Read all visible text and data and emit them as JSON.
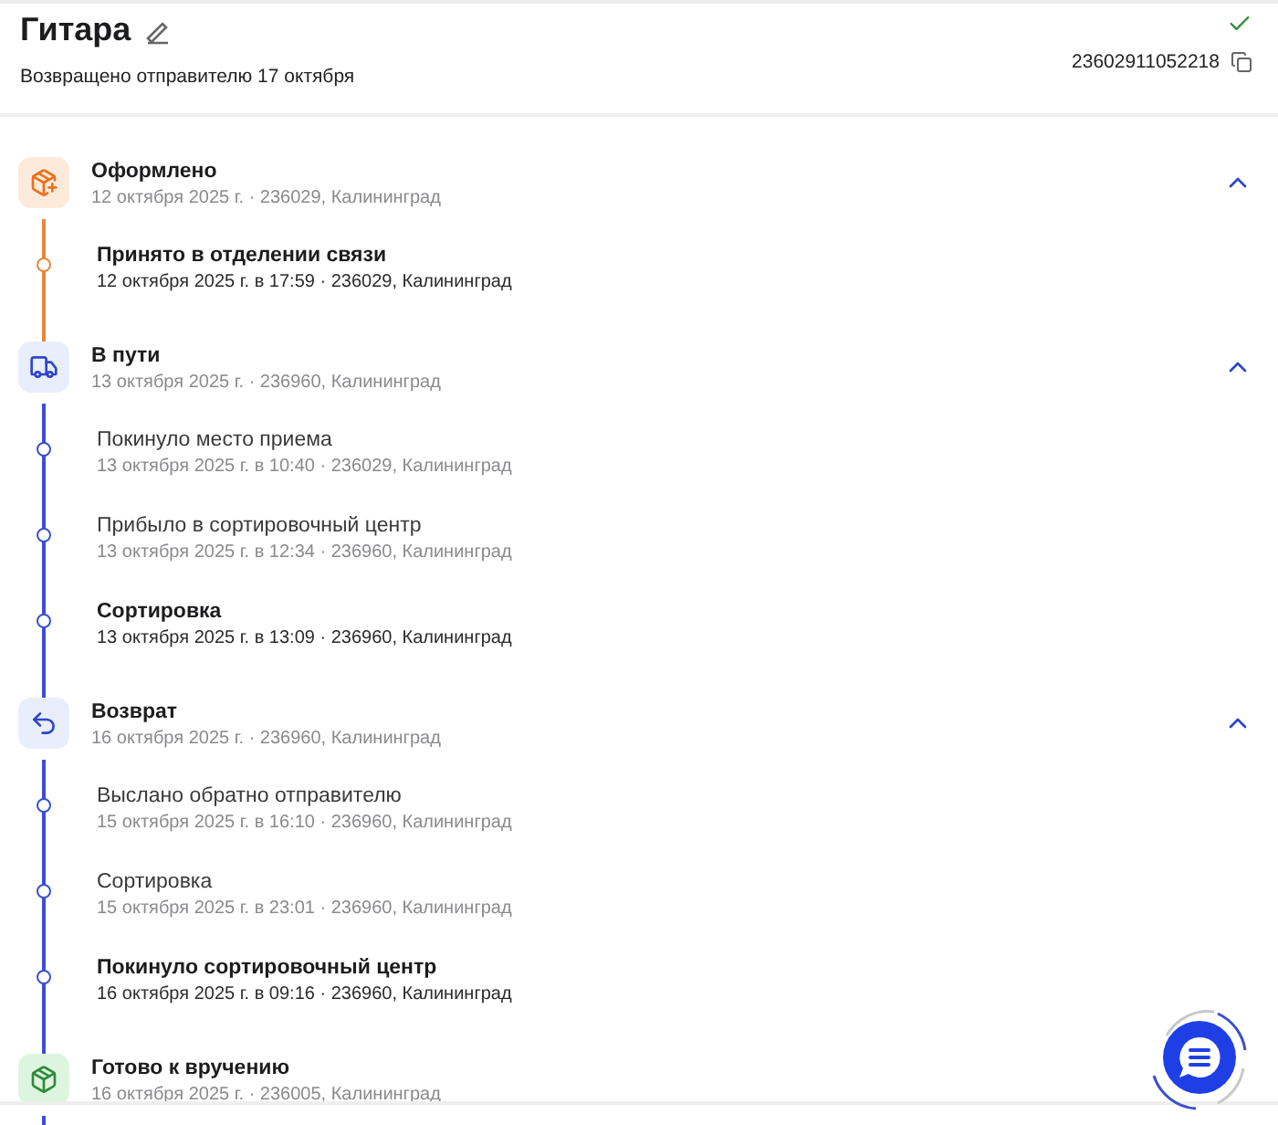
{
  "parcel": {
    "title": "Гитара",
    "status": "Возвращено отправителю 17 октября",
    "tracking_number": "23602911052218",
    "delivered": true
  },
  "stages": [
    {
      "kind": "created",
      "title": "Оформлено",
      "date": "12 октября 2025 г. · 236029, Калининград",
      "expanded": true,
      "events": [
        {
          "title": "Принято в отделении связи",
          "date": "12 октября 2025 г. в 17:59 · 236029, Калининград",
          "emphasized": true
        }
      ]
    },
    {
      "kind": "transit",
      "title": "В пути",
      "date": "13 октября 2025 г. · 236960, Калининград",
      "expanded": true,
      "events": [
        {
          "title": "Покинуло место приема",
          "date": "13 октября 2025 г. в 10:40 · 236029, Калининград",
          "emphasized": false
        },
        {
          "title": "Прибыло в сортировочный центр",
          "date": "13 октября 2025 г. в 12:34 · 236960, Калининград",
          "emphasized": false
        },
        {
          "title": "Сортировка",
          "date": "13 октября 2025 г. в 13:09 · 236960, Калининград",
          "emphasized": true
        }
      ]
    },
    {
      "kind": "return",
      "title": "Возврат",
      "date": "16 октября 2025 г. · 236960, Калининград",
      "expanded": true,
      "events": [
        {
          "title": "Выслано обратно отправителю",
          "date": "15 октября 2025 г. в 16:10 · 236960, Калининград",
          "emphasized": false
        },
        {
          "title": "Сортировка",
          "date": "15 октября 2025 г. в 23:01 · 236960, Калининград",
          "emphasized": false
        },
        {
          "title": "Покинуло сортировочный центр",
          "date": "16 октября 2025 г. в 09:16 · 236960, Калининград",
          "emphasized": true
        }
      ]
    },
    {
      "kind": "ready",
      "title": "Готово к вручению",
      "date": "16 октября 2025 г. · 236005, Калининград"
    }
  ]
}
